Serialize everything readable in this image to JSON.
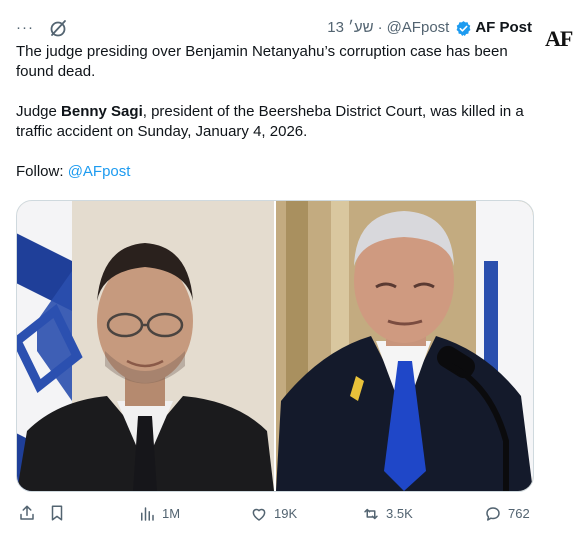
{
  "post": {
    "author_name": "AF Post",
    "handle": "@AFpost",
    "separator": "·",
    "date": "13 שע׳",
    "more_label": "···",
    "text_line1": "The judge presiding over Benjamin Netanyahu’s corruption case has been found dead.",
    "text_p2_before": "Judge ",
    "text_p2_bold": "Benny Sagi",
    "text_p2_after": ", president of the Beersheba District Court, was killed in a traffic accident on Sunday, January 4, 2026.",
    "follow_label": "Follow: ",
    "follow_link": "@AFpost"
  },
  "watermark": {
    "text": "AF"
  },
  "metrics": {
    "views": "1M",
    "likes": "19K",
    "reposts": "3.5K",
    "replies": "762"
  },
  "icons": [
    "more-icon",
    "grok-icon",
    "verified-icon",
    "share-icon",
    "bookmark-icon",
    "views-icon",
    "like-icon",
    "repost-icon",
    "reply-icon"
  ],
  "colors": {
    "accent": "#1d9bf0",
    "muted": "#536471",
    "text": "#0f1419"
  }
}
